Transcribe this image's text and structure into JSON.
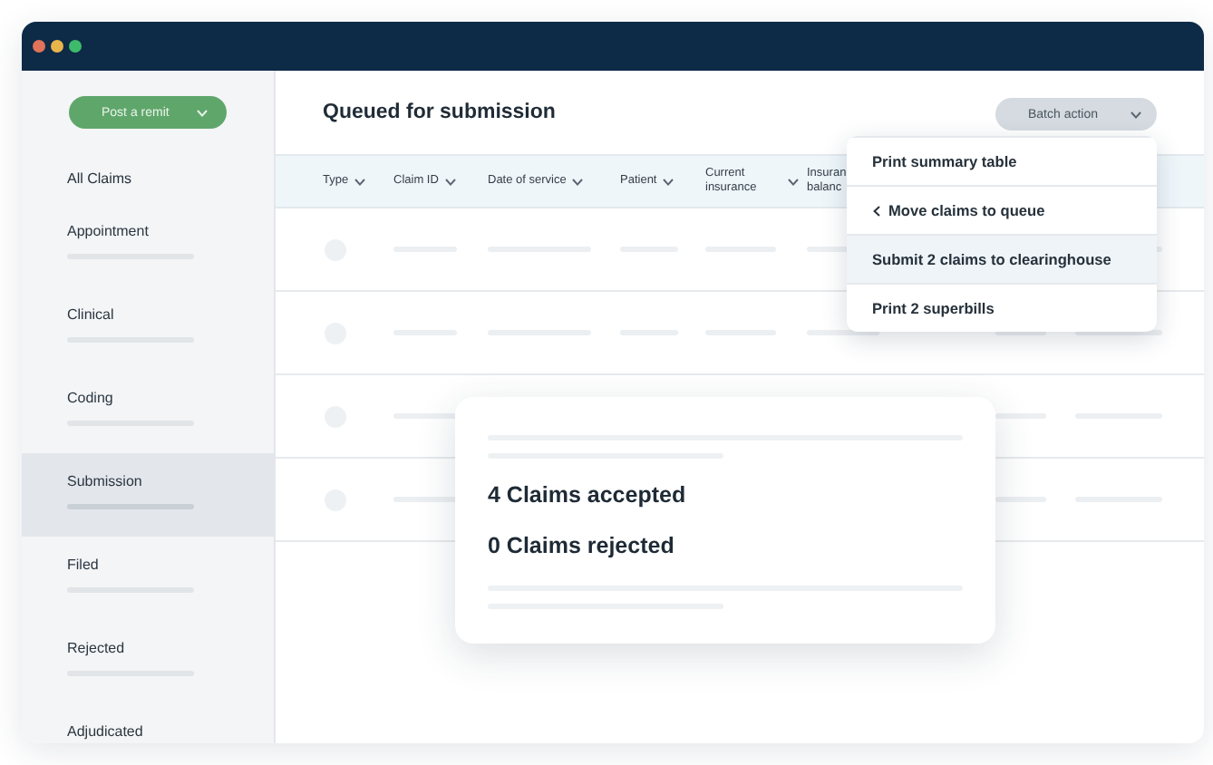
{
  "window": {
    "controls": [
      {
        "color": "#e0735a"
      },
      {
        "color": "#e8b54a"
      },
      {
        "color": "#3dbb6a"
      }
    ]
  },
  "sidebar": {
    "button": {
      "label": "Post a remit"
    },
    "heading": "All Claims",
    "items": [
      {
        "label": "Appointment",
        "selected": false
      },
      {
        "label": "Clinical",
        "selected": false
      },
      {
        "label": "Coding",
        "selected": false
      },
      {
        "label": "Submission",
        "selected": true
      },
      {
        "label": "Filed",
        "selected": false
      },
      {
        "label": "Rejected",
        "selected": false
      },
      {
        "label": "Adjudicated",
        "selected": false
      }
    ]
  },
  "main": {
    "title": "Queued for submission",
    "batch_button": {
      "label": "Batch action"
    },
    "table": {
      "columns": [
        {
          "kind": "label",
          "label": "Type"
        },
        {
          "kind": "label",
          "label": "Claim ID"
        },
        {
          "kind": "label",
          "label": "Date of service"
        },
        {
          "kind": "label",
          "label": "Patient"
        },
        {
          "kind": "label",
          "label": "Current insurance"
        },
        {
          "kind": "label-covered",
          "label": "Insuran balanc"
        },
        {
          "kind": "covered"
        },
        {
          "kind": "covered-chevron"
        }
      ],
      "rows": [
        {
          "kind": "placeholder"
        },
        {
          "kind": "placeholder"
        },
        {
          "kind": "placeholder"
        },
        {
          "kind": "placeholder"
        }
      ]
    },
    "menu": {
      "items": [
        {
          "kind": "plain",
          "label": "Print summary table",
          "selected": false
        },
        {
          "kind": "back",
          "label": "Move claims to queue",
          "selected": false
        },
        {
          "kind": "plain",
          "label": "Submit 2 claims to clearinghouse",
          "selected": true
        },
        {
          "kind": "plain",
          "label": "Print 2 superbills",
          "selected": false
        }
      ]
    },
    "result": {
      "lines": [
        "4 Claims accepted",
        "0 Claims rejected"
      ]
    }
  }
}
